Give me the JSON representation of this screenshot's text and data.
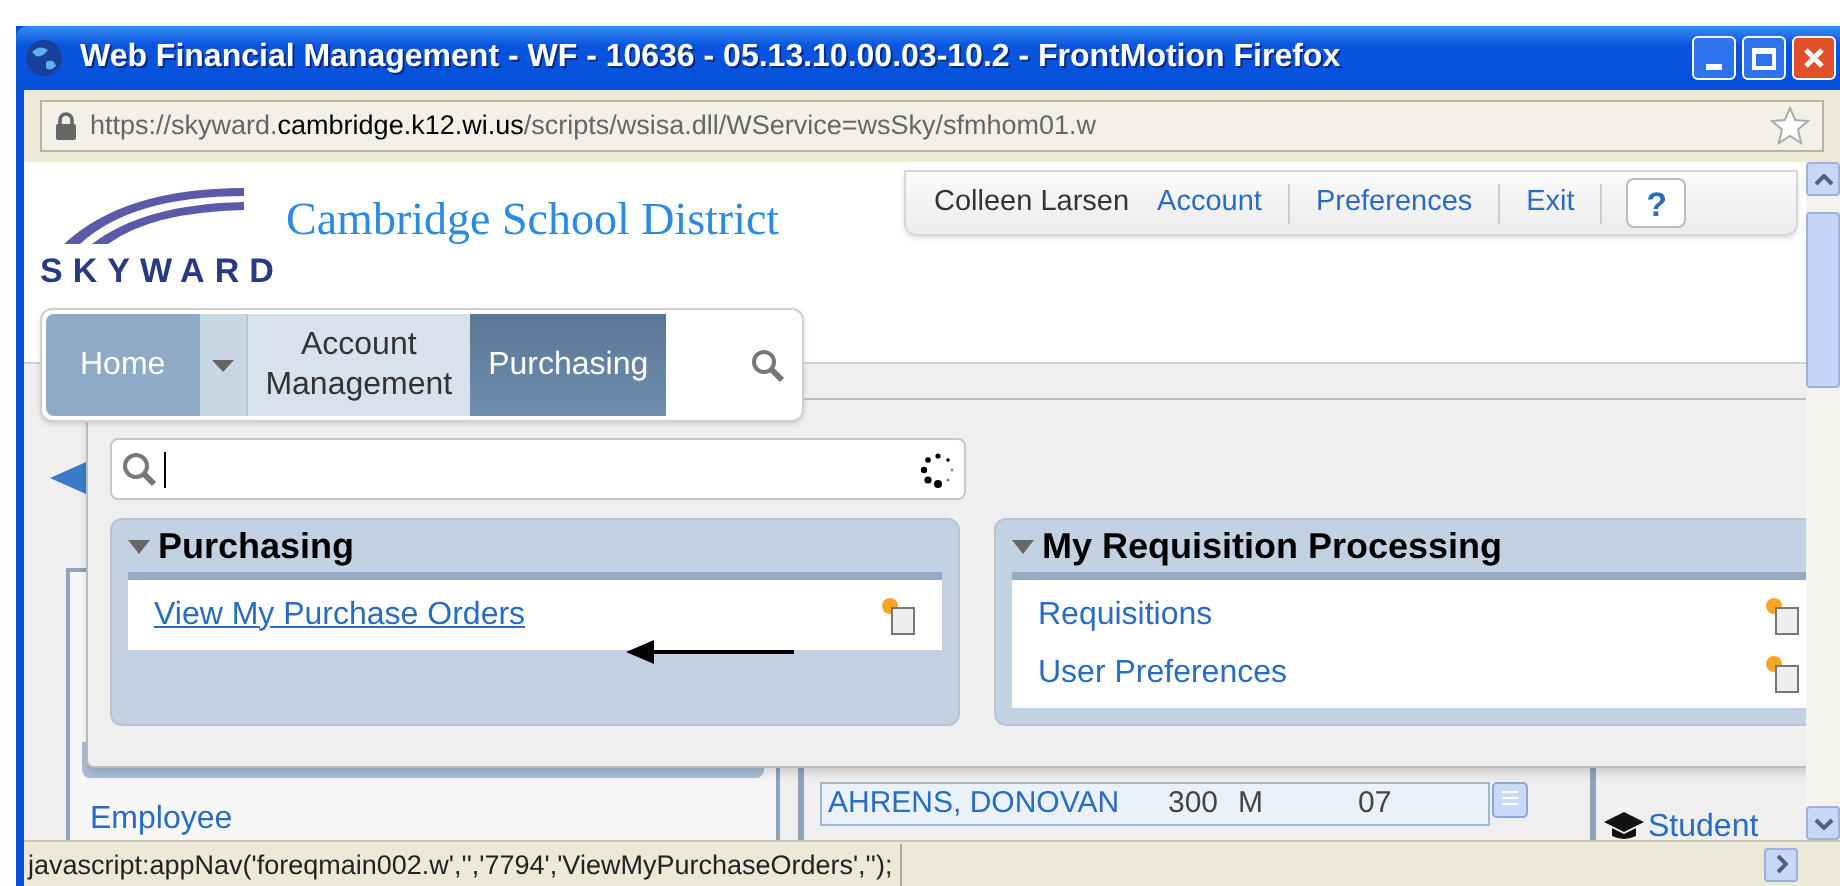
{
  "window": {
    "title": "Web Financial Management - WF - 10636 - 05.13.10.00.03-10.2 - FrontMotion Firefox"
  },
  "address_bar": {
    "url_parts": [
      {
        "text": "https://skyward.",
        "emphasis": false
      },
      {
        "text": "cambridge.k12.wi.us",
        "emphasis": true
      },
      {
        "text": "/scripts/wsisa.dll/WService=wsSky/sfmhom01.w",
        "emphasis": false
      }
    ]
  },
  "header": {
    "logo_text": "SKYWARD",
    "district": "Cambridge School District",
    "user": "Colleen Larsen",
    "links": [
      "Account",
      "Preferences",
      "Exit"
    ],
    "help": "?"
  },
  "nav_tabs": [
    {
      "label": "Home",
      "kind": "home",
      "selected": false
    },
    {
      "label": "Account Management",
      "kind": "tab",
      "selected": false
    },
    {
      "label": "Purchasing",
      "kind": "tab",
      "selected": true
    }
  ],
  "groups": [
    {
      "title": "Purchasing",
      "expanded": true,
      "items": [
        {
          "label": "View My Purchase Orders",
          "hovered": true
        }
      ]
    },
    {
      "title": "My Requisition Processing",
      "expanded": true,
      "items": [
        {
          "label": "Requisitions",
          "hovered": false
        },
        {
          "label": "User Preferences",
          "hovered": false
        }
      ]
    }
  ],
  "background": {
    "left_link": "Employee",
    "row": [
      "AHRENS, DONOVAN",
      "300",
      "M",
      "07"
    ],
    "right_link": "Student"
  },
  "status_bar": {
    "text": "javascript:appNav('foreqmain002.w','','7794','ViewMyPurchaseOrders','');"
  }
}
